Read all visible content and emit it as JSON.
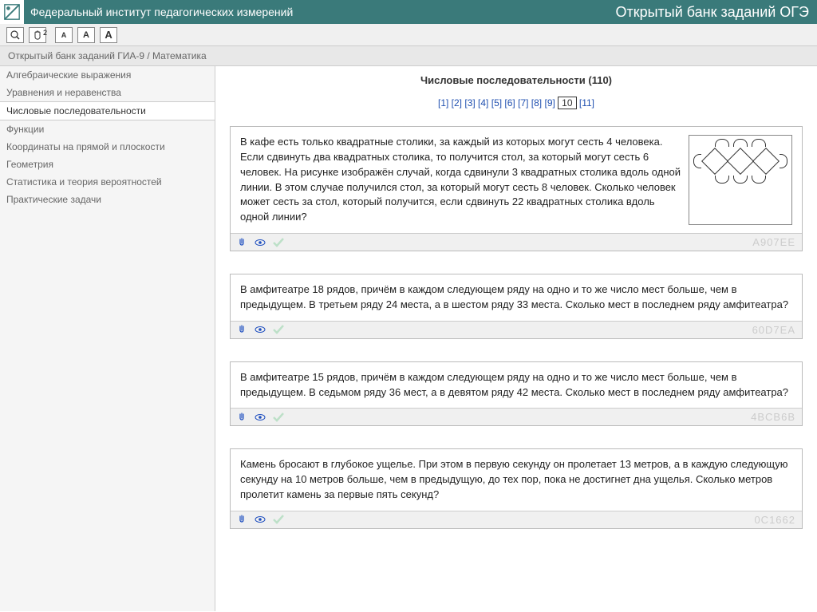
{
  "header": {
    "institute": "Федеральный институт педагогических измерений",
    "bank_title": "Открытый банк заданий ОГЭ"
  },
  "toolbar": {
    "zoom_badge": "2",
    "font_a": "A"
  },
  "breadcrumb": "Открытый банк заданий ГИА-9 / Математика",
  "sidebar": {
    "items": [
      "Алгебраические выражения",
      "Уравнения и неравенства",
      "Числовые последовательности",
      "Функции",
      "Координаты на прямой и плоскости",
      "Геометрия",
      "Статистика и теория вероятностей",
      "Практические задачи"
    ],
    "active_index": 2
  },
  "content": {
    "title": "Числовые последовательности (110)",
    "pages": [
      "1",
      "2",
      "3",
      "4",
      "5",
      "6",
      "7",
      "8",
      "9",
      "10",
      "11"
    ],
    "current_page": "10"
  },
  "tasks": [
    {
      "text": "В кафе есть только квадратные столики, за каждый из которых могут сесть 4 человека. Если сдвинуть два квадратных столика, то получится стол, за который могут сесть 6 человек. На рисунке изображён случай, когда сдвинули 3 квадратных столика вдоль одной линии. В этом случае получился стол, за который могут сесть 8 человек. Сколько человек может сесть за стол, который получится, если сдвинуть 22 квадратных столика вдоль одной линии?",
      "has_image": true,
      "code": "A907EE"
    },
    {
      "text": "В амфитеатре 18 рядов, причём в каждом следующем ряду на одно и то же число мест больше, чем в предыдущем. В третьем ряду 24 места, а в шестом ряду 33 места. Сколько мест в последнем ряду амфитеатра?",
      "has_image": false,
      "code": "60D7EA"
    },
    {
      "text": "В амфитеатре 15 рядов, причём в каждом следующем ряду на одно и то же число мест больше, чем в предыдущем. В седьмом ряду 36 мест, а в девятом ряду 42 места. Сколько мест в последнем ряду амфитеатра?",
      "has_image": false,
      "code": "4BCB6B"
    },
    {
      "text": "Камень бросают в глубокое ущелье. При этом в первую секунду он пролетает 13 метров, а в каждую следующую секунду на 10 метров больше, чем в предыдущую, до тех пор, пока не достигнет дна ущелья. Сколько метров пролетит камень за первые пять секунд?",
      "has_image": false,
      "code": "0C1662"
    }
  ]
}
